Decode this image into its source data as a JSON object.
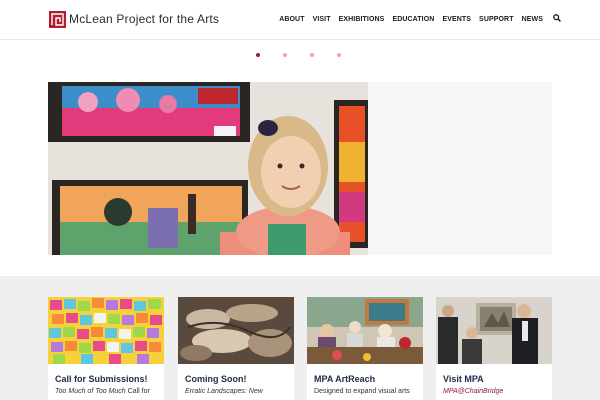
{
  "site": {
    "name": "McLean Project for the Arts"
  },
  "nav": {
    "items": [
      "ABOUT",
      "VISIT",
      "EXHIBITIONS",
      "EDUCATION",
      "EVENTS",
      "SUPPORT",
      "NEWS"
    ]
  },
  "slider": {
    "slide_count": 4,
    "active_index": 0
  },
  "cards": [
    {
      "title": "Call for Submissions!",
      "text_italic": "Too Much of Too Much",
      "text_rest": " Call for"
    },
    {
      "title": "Coming Soon!",
      "text_italic": "Erratic Landscapes: New",
      "text_rest": ""
    },
    {
      "title": "MPA ArtReach",
      "text_italic": "",
      "text_rest": "Designed to expand visual arts"
    },
    {
      "title": "Visit MPA",
      "text_italic": "MPA@ChainBridge",
      "text_rest": ""
    }
  ],
  "colors": {
    "brand": "#b01e2e",
    "heading": "#1d2a4a",
    "dot_active": "#9b1f2a",
    "dot_inactive": "#e3a7ae"
  }
}
